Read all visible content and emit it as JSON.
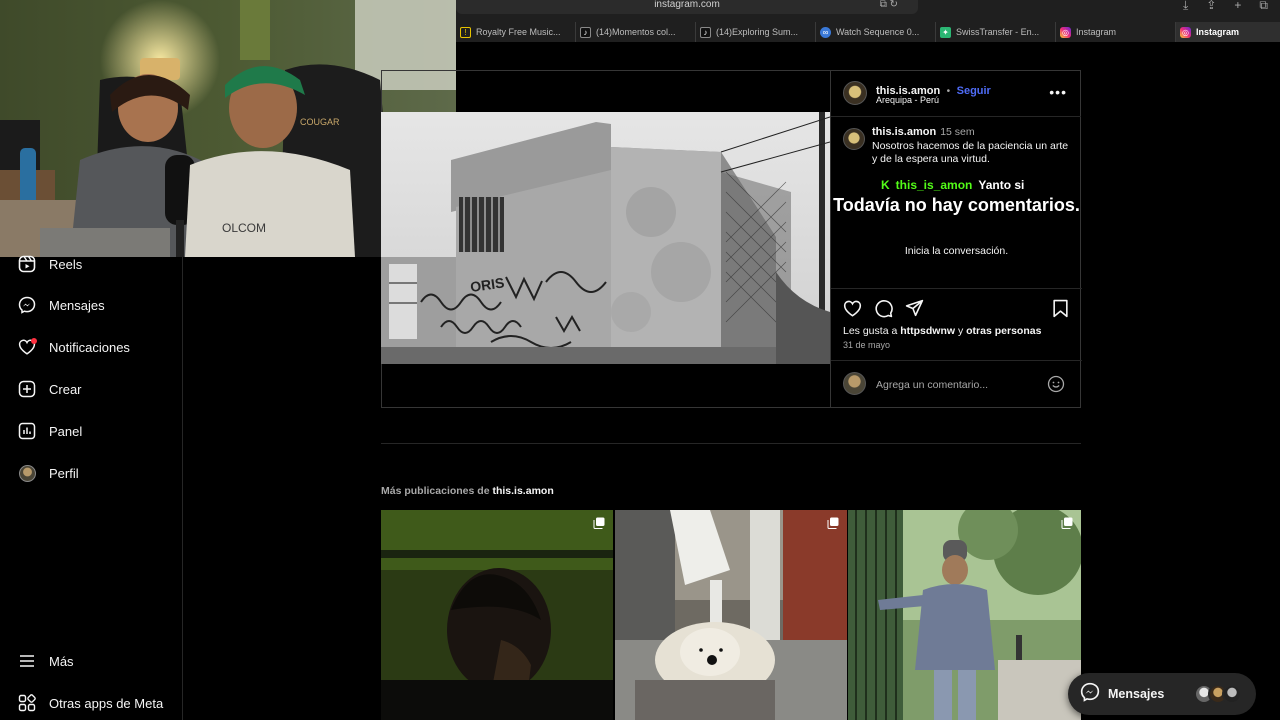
{
  "browser": {
    "url": "instagram.com",
    "tabs": [
      {
        "label": "Royalty Free Music...",
        "icon": "warning-triangle-icon"
      },
      {
        "label": "(14)Momentos col...",
        "icon": "tiktok-icon"
      },
      {
        "label": "(14)Exploring Sum...",
        "icon": "tiktok-icon"
      },
      {
        "label": "Watch Sequence 0...",
        "icon": "sequence-icon"
      },
      {
        "label": "SwissTransfer - En...",
        "icon": "swisstransfer-icon"
      },
      {
        "label": "Instagram",
        "icon": "instagram-icon"
      },
      {
        "label": "Instagram",
        "icon": "instagram-icon",
        "active": true
      }
    ]
  },
  "sidebar": {
    "items": [
      {
        "label": "Reels",
        "icon": "reels-icon"
      },
      {
        "label": "Mensajes",
        "icon": "messenger-icon"
      },
      {
        "label": "Notificaciones",
        "icon": "heart-icon",
        "badge": true
      },
      {
        "label": "Crear",
        "icon": "plus-square-icon"
      },
      {
        "label": "Panel",
        "icon": "bar-chart-icon"
      },
      {
        "label": "Perfil",
        "icon": "profile-avatar"
      }
    ],
    "bottom": [
      {
        "label": "Más",
        "icon": "hamburger-icon"
      },
      {
        "label": "Otras apps de Meta",
        "icon": "meta-apps-icon"
      }
    ]
  },
  "post": {
    "username": "this.is.amon",
    "separator": "•",
    "follow": "Seguir",
    "location": "Arequipa - Perú",
    "caption_user": "this.is.amon",
    "caption_time": "15 sem",
    "caption_text": "Nosotros hacemos de la paciencia un arte y de la espera una virtud.",
    "no_comments": "Todavía no hay comentarios.",
    "start_conversation": "Inicia la conversación.",
    "likes_prefix": "Les gusta a",
    "likes_user": "httpsdwnw",
    "likes_and": "y",
    "likes_others": "otras personas",
    "date": "31 de mayo",
    "comment_placeholder": "Agrega un comentario..."
  },
  "overlay_chat": {
    "platform_letter": "K",
    "user": "this_is_amon",
    "message": "Yanto si"
  },
  "more_posts": {
    "prefix": "Más publicaciones de",
    "user": "this.is.amon"
  },
  "messages_pill": {
    "label": "Mensajes"
  },
  "colors": {
    "follow_blue": "#4f6cf7",
    "kick_green": "#53fc18",
    "notification_red": "#ff3040"
  }
}
